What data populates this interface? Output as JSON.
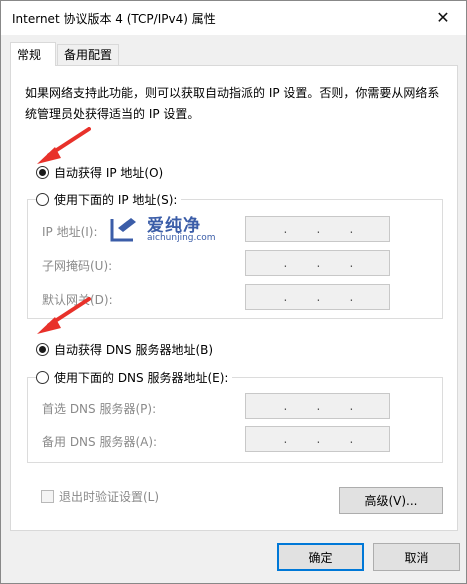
{
  "window": {
    "title": "Internet 协议版本 4 (TCP/IPv4) 属性",
    "close_glyph": "✕"
  },
  "tabs": [
    {
      "label": "常规",
      "active": true
    },
    {
      "label": "备用配置",
      "active": false
    }
  ],
  "description": "如果网络支持此功能，则可以获取自动指派的 IP 设置。否则，你需要从网络系统管理员处获得适当的 IP 设置。",
  "ip_section": {
    "auto_label": "自动获得 IP 地址(O)",
    "auto_checked": true,
    "manual_label": "使用下面的 IP 地址(S):",
    "manual_checked": false,
    "fields": [
      {
        "label": "IP 地址(I):",
        "value": ""
      },
      {
        "label": "子网掩码(U):",
        "value": ""
      },
      {
        "label": "默认网关(D):",
        "value": ""
      }
    ]
  },
  "dns_section": {
    "auto_label": "自动获得 DNS 服务器地址(B)",
    "auto_checked": true,
    "manual_label": "使用下面的 DNS 服务器地址(E):",
    "manual_checked": false,
    "fields": [
      {
        "label": "首选 DNS 服务器(P):",
        "value": ""
      },
      {
        "label": "备用 DNS 服务器(A):",
        "value": ""
      }
    ]
  },
  "ip_dots": ".",
  "validate_checkbox": {
    "label": "退出时验证设置(L)",
    "checked": false,
    "enabled": false
  },
  "buttons": {
    "advanced": "高级(V)...",
    "ok": "确定",
    "cancel": "取消"
  },
  "watermark": {
    "name_cn": "爱纯净",
    "domain": "aichunjing.com"
  },
  "colors": {
    "arrow": "#e8312a",
    "watermark": "#3b5da8",
    "focus_border": "#0078d7"
  }
}
